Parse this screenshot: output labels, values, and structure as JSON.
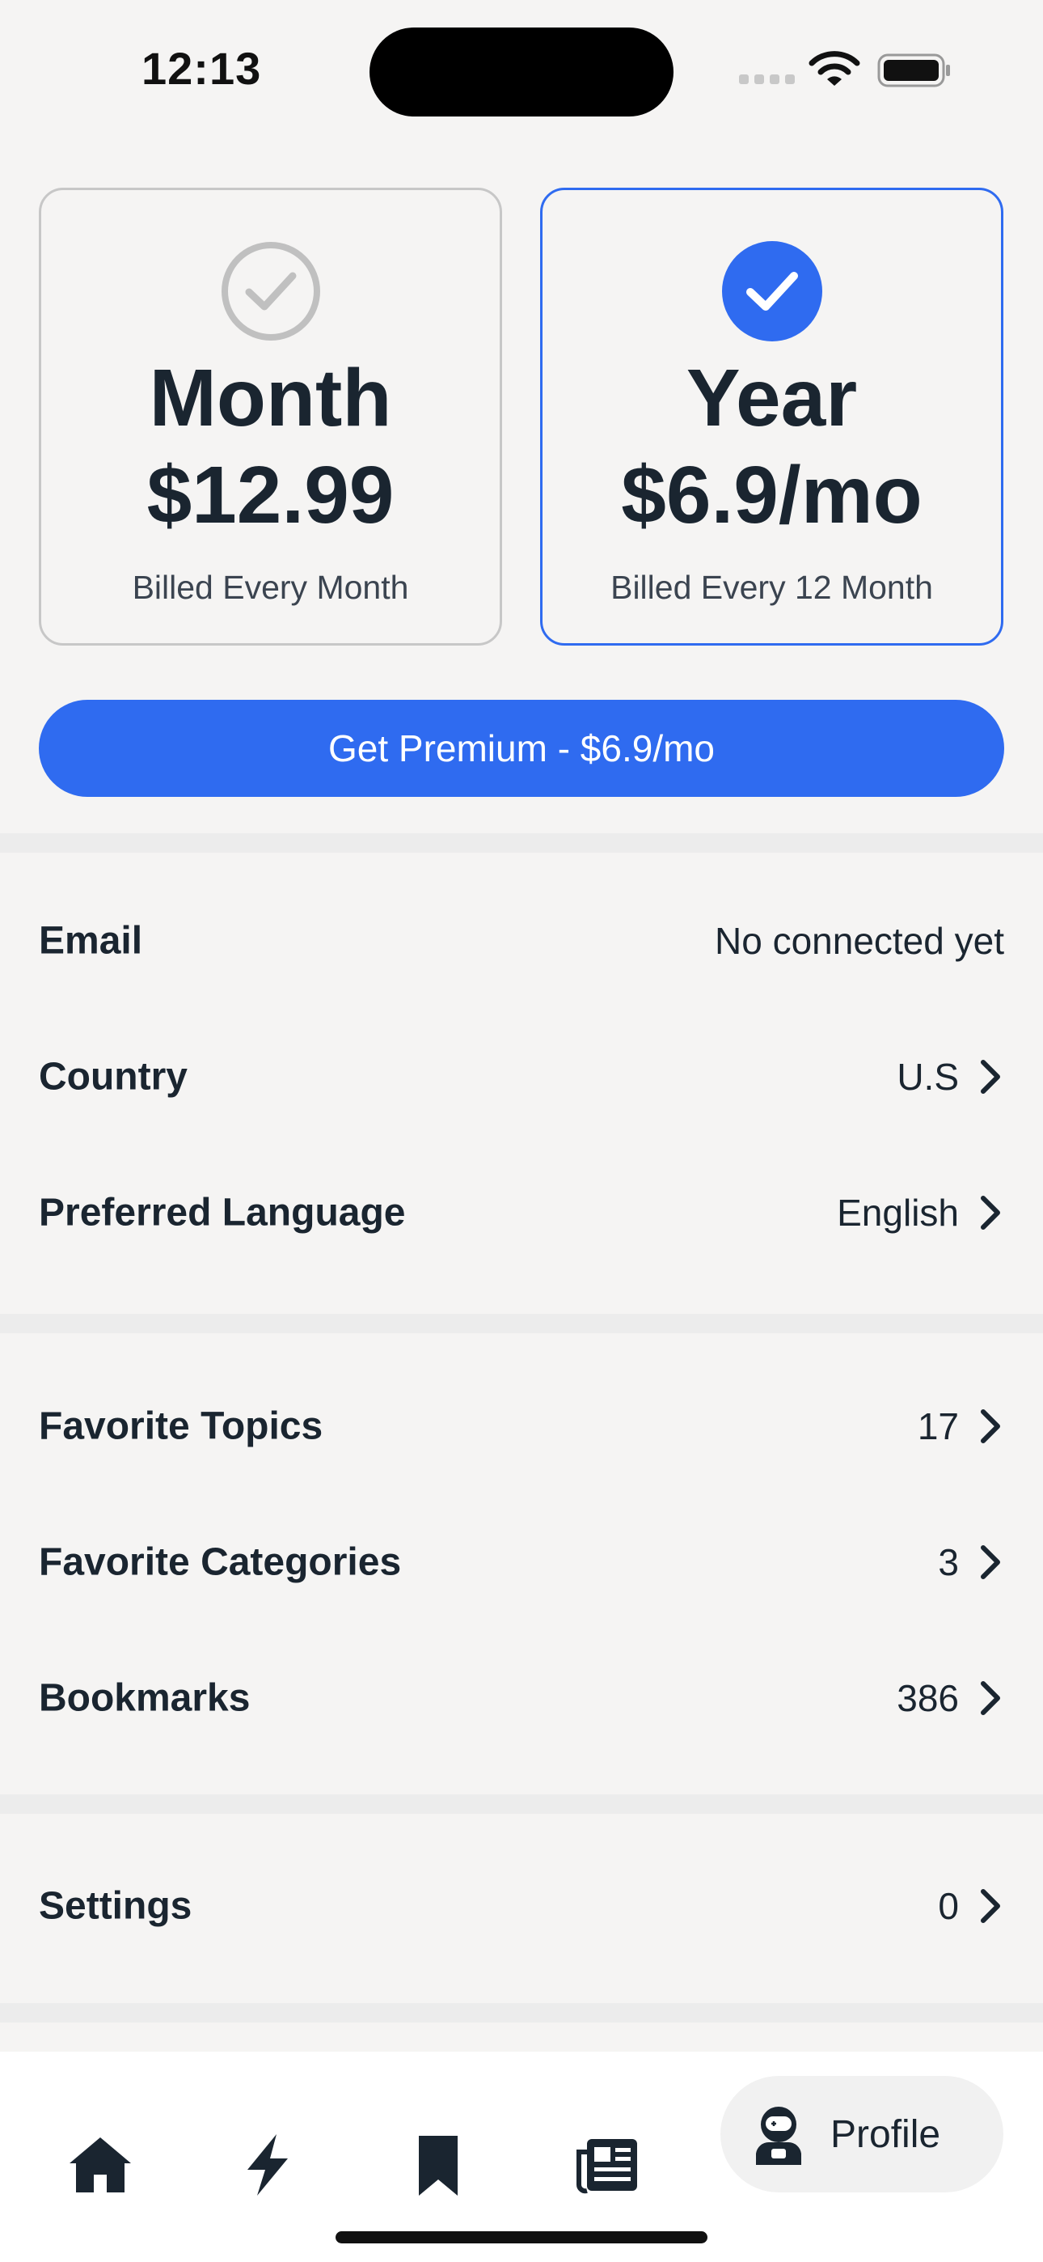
{
  "status_bar": {
    "time": "12:13"
  },
  "plans": [
    {
      "name": "Month",
      "price": "$12.99",
      "billing": "Billed Every Month",
      "selected": false
    },
    {
      "name": "Year",
      "price": "$6.9/mo",
      "billing": "Billed Every 12 Month",
      "selected": true
    }
  ],
  "premium_button": {
    "label": "Get Premium - $6.9/mo"
  },
  "account": [
    {
      "label": "Email",
      "value": "No connected yet"
    },
    {
      "label": "Country",
      "value": "U.S"
    },
    {
      "label": "Preferred Language",
      "value": "English"
    }
  ],
  "favorites": [
    {
      "label": "Favorite Topics",
      "value": "17"
    },
    {
      "label": "Favorite Categories",
      "value": "3"
    },
    {
      "label": "Bookmarks",
      "value": "386"
    }
  ],
  "settings": {
    "label": "Settings",
    "value": "0"
  },
  "tab_bar": {
    "items": [
      "home-icon",
      "lightning-icon",
      "bookmark-icon",
      "newspaper-icon"
    ],
    "active_label": "Profile"
  },
  "colors": {
    "accent": "#2f6bf0",
    "text": "#1a2530",
    "background": "#f5f4f3",
    "divider": "#ececec"
  }
}
